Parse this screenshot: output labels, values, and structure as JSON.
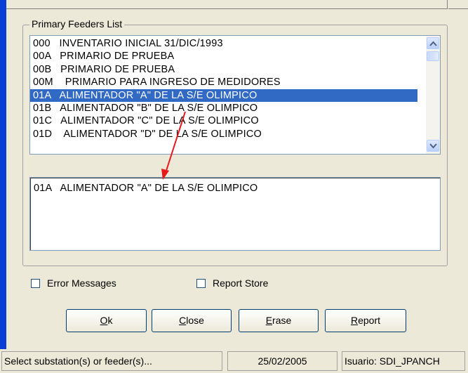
{
  "group_title": "Primary Feeders List",
  "feeders": [
    {
      "code": "000",
      "name": "INVENTARIO INICIAL 31/DIC/1993"
    },
    {
      "code": "00A",
      "name": "PRIMARIO DE PRUEBA"
    },
    {
      "code": "00B",
      "name": "PRIMARIO DE PRUEBA"
    },
    {
      "code": "00M",
      "name": " PRIMARIO PARA INGRESO DE MEDIDORES"
    },
    {
      "code": "01A",
      "name": "ALIMENTADOR \"A\" DE LA S/E OLIMPICO",
      "selected": true
    },
    {
      "code": "01B",
      "name": "ALIMENTADOR \"B\" DE LA S/E OLIMPICO"
    },
    {
      "code": "01C",
      "name": "ALIMENTADOR \"C\" DE LA S/E OLIMPICO"
    },
    {
      "code": "01D",
      "name": " ALIMENTADOR \"D\" DE LA S/E OLIMPICO"
    }
  ],
  "selected_detail": "01A   ALIMENTADOR \"A\" DE LA S/E OLIMPICO",
  "checkboxes": {
    "error_messages": {
      "label": "Error Messages",
      "checked": false
    },
    "report_store": {
      "label": "Report Store",
      "checked": false
    }
  },
  "buttons": {
    "ok": {
      "accel": "O",
      "rest": "k"
    },
    "close": {
      "accel": "C",
      "rest": "lose"
    },
    "erase": {
      "accel": "E",
      "rest": "rase"
    },
    "report": {
      "accel": "R",
      "rest": "eport"
    }
  },
  "status": {
    "message": "Select substation(s) or feeder(s)...",
    "date": "25/02/2005",
    "user": "Isuario: SDI_JPANCH"
  },
  "colors": {
    "selection": "#316ac5",
    "annotation_arrow": "#e8171c",
    "window_bg": "#ece9d8"
  },
  "icons": {
    "scroll_up": "chevron-up-icon",
    "scroll_down": "chevron-down-icon"
  }
}
